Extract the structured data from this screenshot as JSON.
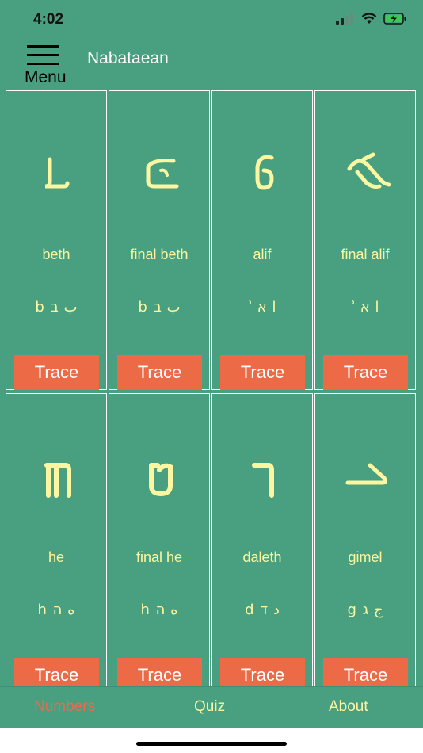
{
  "status_bar": {
    "time": "4:02"
  },
  "app_bar": {
    "menu_label": "Menu",
    "title": "Nabataean"
  },
  "letters": [
    {
      "name": "beth",
      "translit": "b ب ב"
    },
    {
      "name": "final beth",
      "translit": "b ب ב"
    },
    {
      "name": "alif",
      "translit": "ʾ ا א"
    },
    {
      "name": "final alif",
      "translit": "ʾ ا א"
    },
    {
      "name": "he",
      "translit": "h ه ה"
    },
    {
      "name": "final he",
      "translit": "h ه ה"
    },
    {
      "name": "daleth",
      "translit": "d د ד"
    },
    {
      "name": "gimel",
      "translit": "g ج ג"
    }
  ],
  "trace_label": "Trace",
  "tabs": [
    {
      "label": "Numbers",
      "active": true
    },
    {
      "label": "Quiz",
      "active": false
    },
    {
      "label": "About",
      "active": false
    }
  ],
  "colors": {
    "background": "#48a080",
    "accent": "#ed6a47",
    "glyph": "#fdf6a0",
    "card_border": "#ffffff",
    "active_tab": "#ed6a47",
    "inactive_tab": "#fdf6a0"
  }
}
